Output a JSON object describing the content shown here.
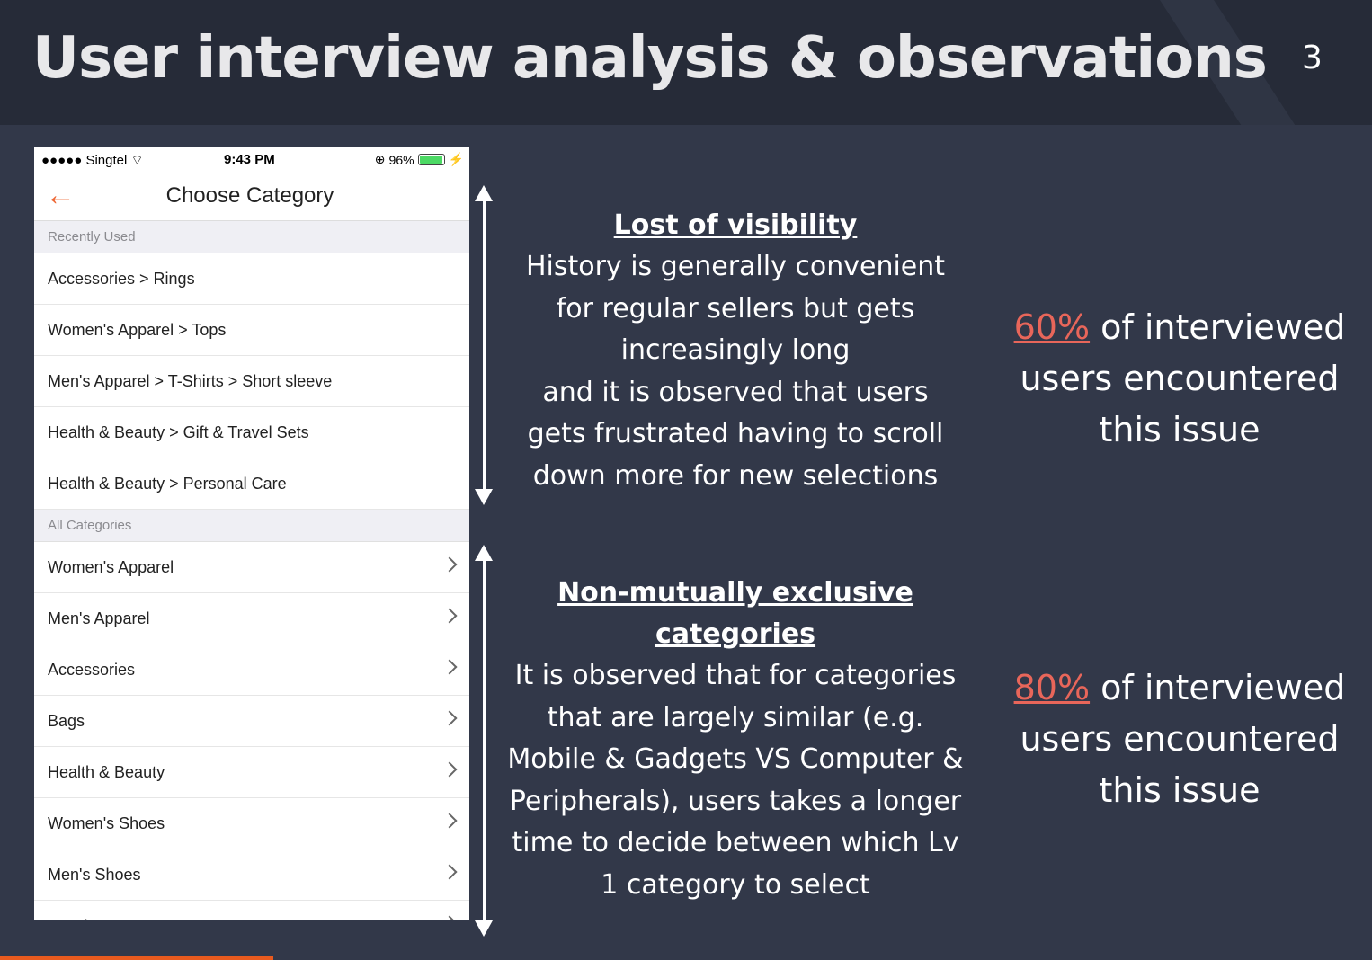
{
  "slide": {
    "title": "User interview analysis & observations",
    "page_number": "3"
  },
  "phone": {
    "status_bar": {
      "carrier": "●●●●● Singtel",
      "time": "9:43 PM",
      "battery": "96%",
      "battery_level": 0.96
    },
    "nav": {
      "title": "Choose Category"
    },
    "recent_header": "Recently Used",
    "recent_items": [
      "Accessories > Rings",
      "Women's Apparel > Tops",
      "Men's Apparel > T-Shirts > Short sleeve",
      "Health & Beauty > Gift & Travel Sets",
      "Health & Beauty > Personal Care"
    ],
    "all_header": "All Categories",
    "all_items": [
      "Women's Apparel",
      "Men's Apparel",
      "Accessories",
      "Bags",
      "Health & Beauty",
      "Women's Shoes",
      "Men's Shoes",
      "Watches"
    ]
  },
  "observation1": {
    "heading": "Lost of visibility",
    "lines": [
      "History is generally convenient",
      "for regular sellers but gets",
      "increasingly long",
      "and it is observed that users",
      "gets frustrated having to scroll",
      "down more for new selections"
    ]
  },
  "observation2": {
    "heading_lines": [
      "Non-mutually exclusive",
      "categories"
    ],
    "lines": [
      "It is observed that for categories",
      "that are largely similar (e.g.",
      "Mobile & Gadgets VS Computer &",
      "Peripherals), users takes a longer",
      "time to decide between which Lv",
      "1 category to select"
    ]
  },
  "stat1": {
    "percent": "60%",
    "line1_rest": " of interviewed",
    "line2": "users encountered",
    "line3": "this issue"
  },
  "stat2": {
    "percent": "80%",
    "line1_rest": " of interviewed",
    "line2": "users encountered",
    "line3": "this issue"
  },
  "colors": {
    "background": "#323849",
    "header": "#262b38",
    "accent_orange": "#ee6633",
    "stat_highlight": "#e8665a"
  }
}
